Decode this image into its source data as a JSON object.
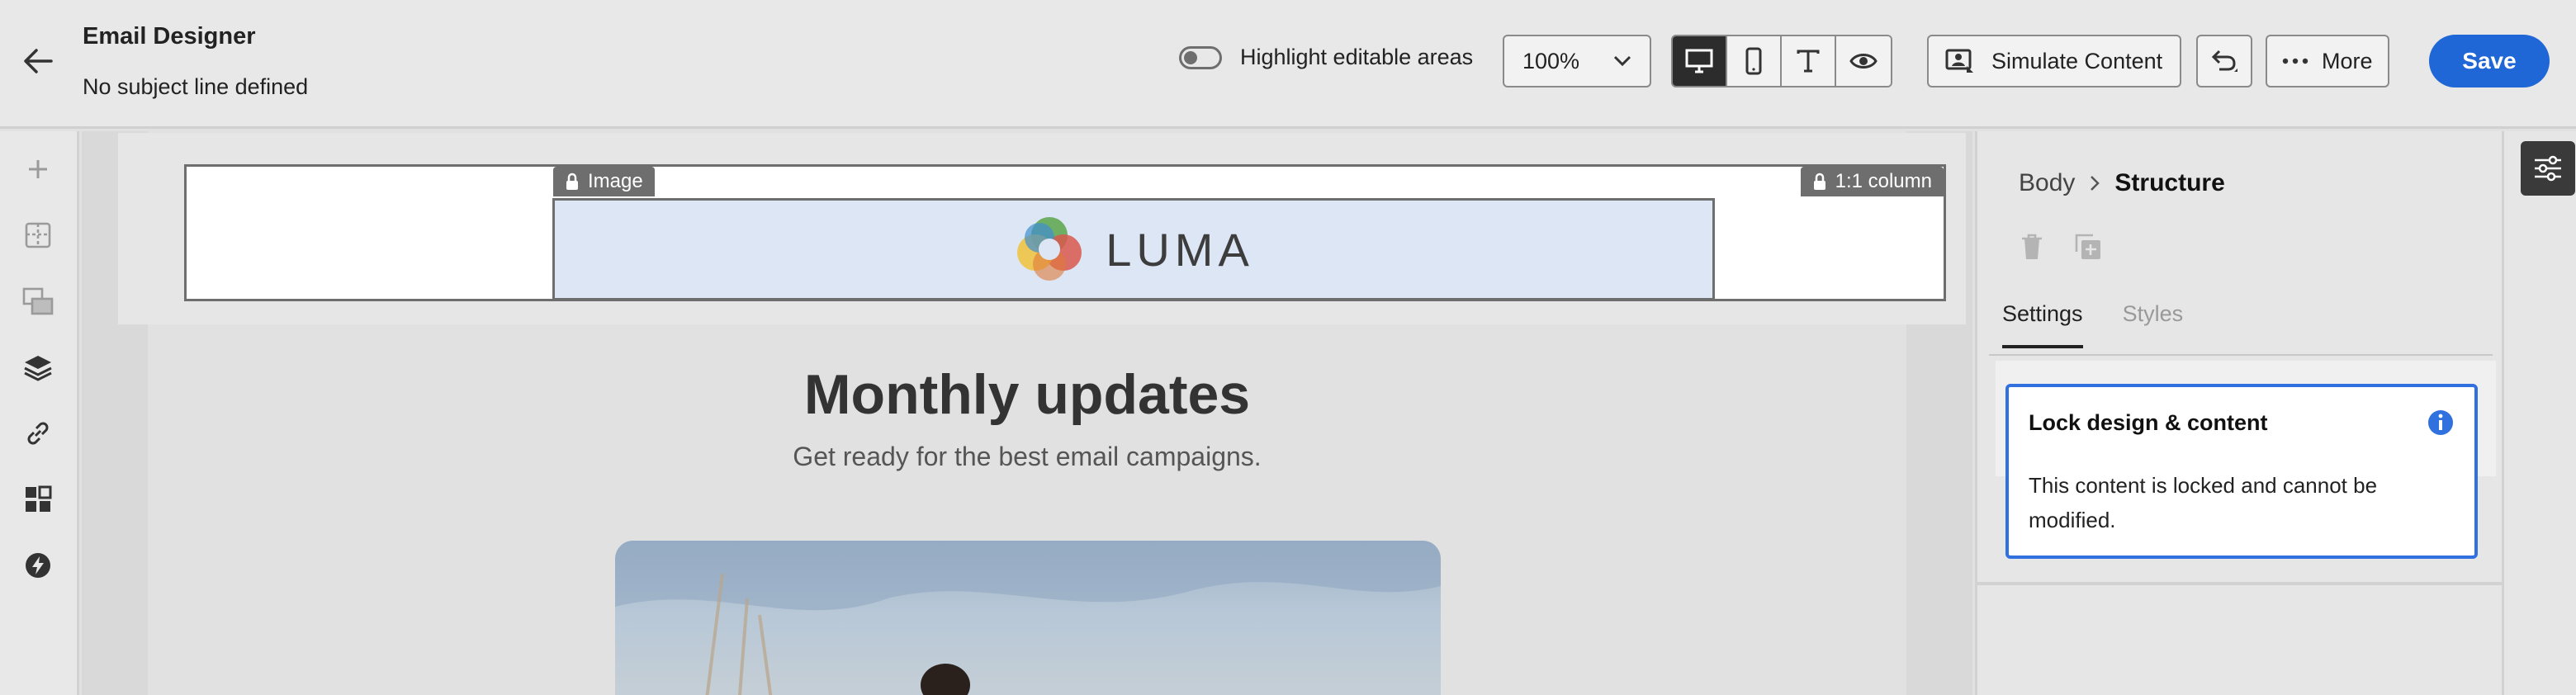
{
  "header": {
    "title": "Email Designer",
    "subtitle": "No subject line defined",
    "highlight_label": "Highlight editable areas",
    "zoom": "100%",
    "simulate_label": "Simulate Content",
    "more_label": "More",
    "save_label": "Save"
  },
  "canvas": {
    "image_tag": "Image",
    "column_tag": "1:1 column",
    "logo_text": "LUMA",
    "heading": "Monthly updates",
    "subheading": "Get ready for the best email campaigns."
  },
  "panel": {
    "breadcrumb_parent": "Body",
    "breadcrumb_current": "Structure",
    "tabs": [
      "Settings",
      "Styles"
    ],
    "lock_title": "Lock design & content",
    "lock_desc": "This content is locked and cannot be modified."
  },
  "colors": {
    "accent": "#1f66d6",
    "card_border": "#3170df"
  }
}
